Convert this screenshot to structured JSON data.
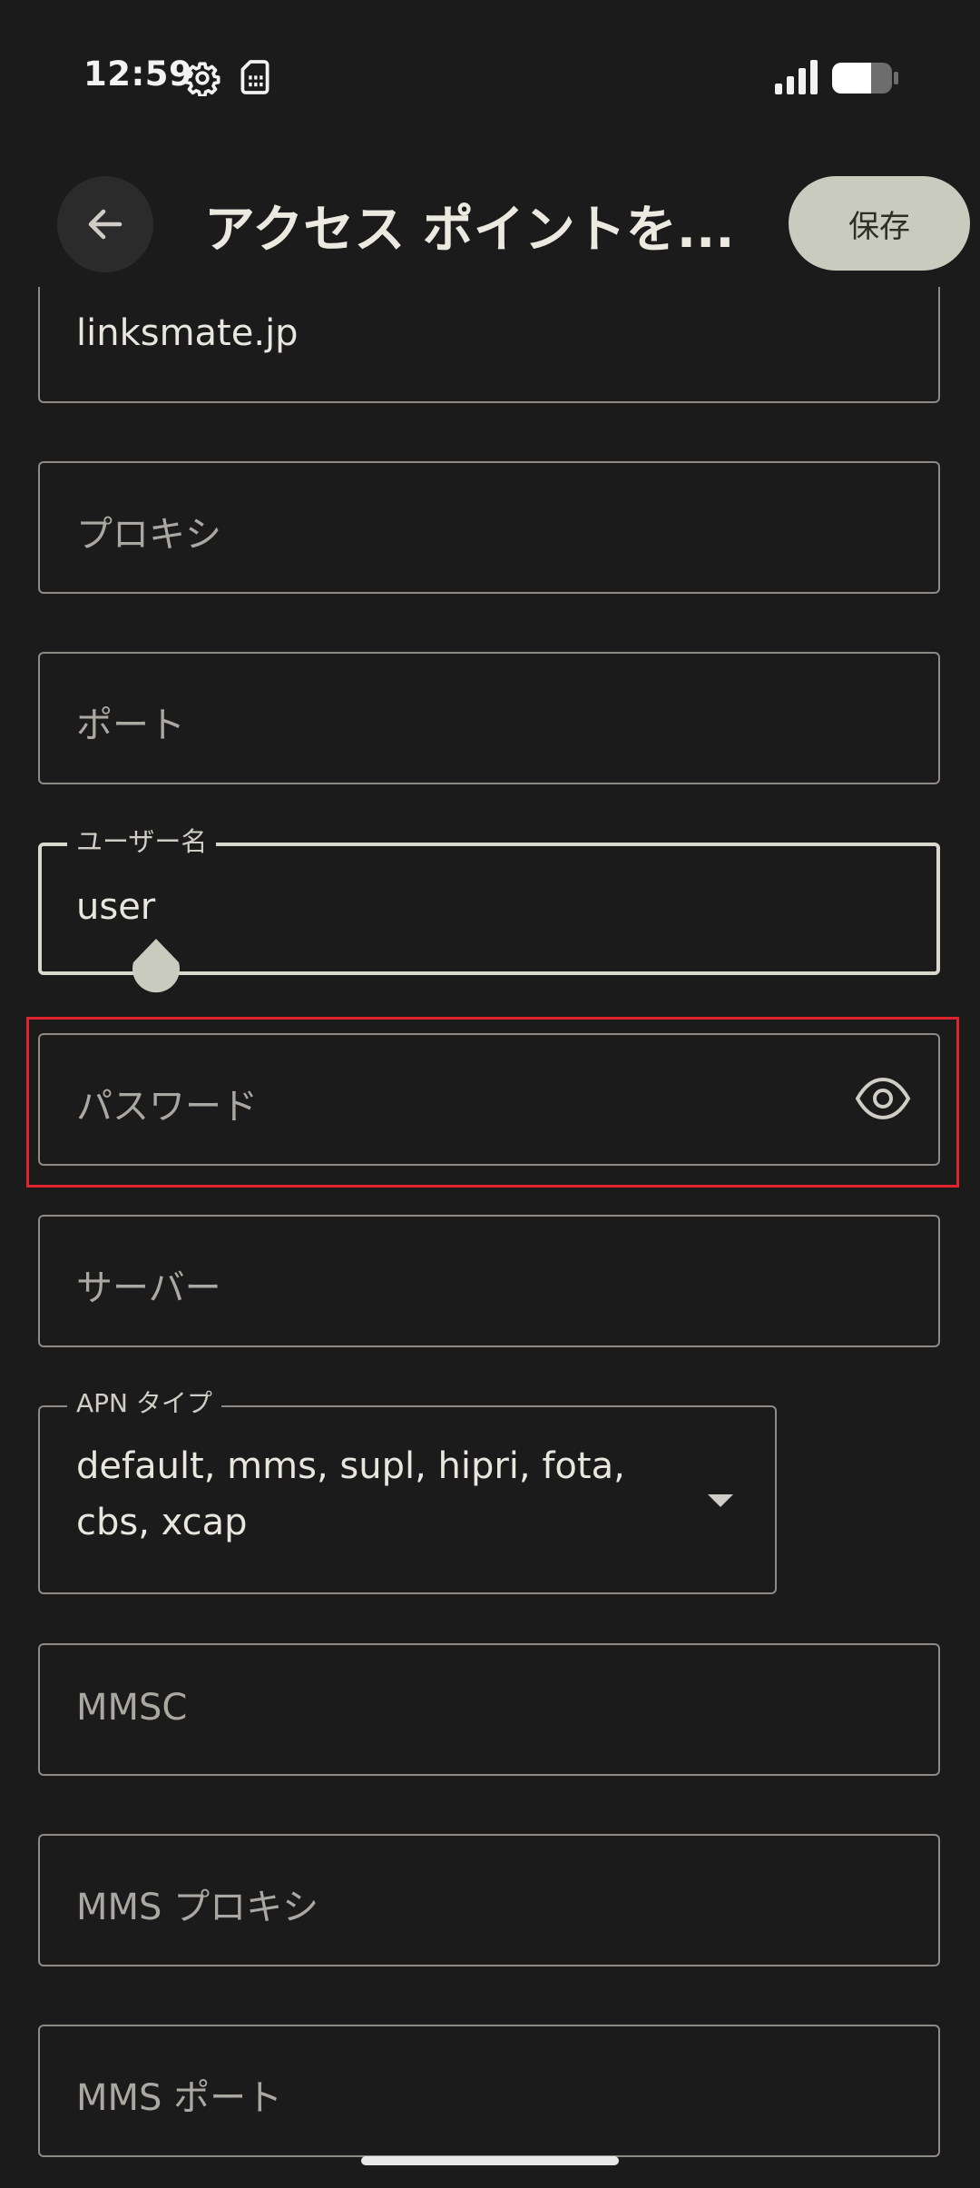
{
  "status_bar": {
    "time": "12:59",
    "icons": [
      "gear-icon",
      "sim-card-icon",
      "signal-icon",
      "battery-icon"
    ]
  },
  "app_bar": {
    "title": "アクセス ポイントを...",
    "save_label": "保存",
    "back_icon": "arrow-left-icon"
  },
  "fields": {
    "apn": {
      "value": "linksmate.jp"
    },
    "proxy": {
      "placeholder": "プロキシ"
    },
    "port": {
      "placeholder": "ポート"
    },
    "username": {
      "label": "ユーザー名",
      "value": "user"
    },
    "password": {
      "placeholder": "パスワード",
      "icon": "eye-icon"
    },
    "server": {
      "placeholder": "サーバー"
    },
    "apn_type": {
      "label": "APN タイプ",
      "value_line1": "default, mms, supl, hipri, fota,",
      "value_line2": "cbs, xcap"
    },
    "mmsc": {
      "placeholder": "MMSC"
    },
    "mms_proxy": {
      "placeholder": "MMS プロキシ"
    },
    "mms_port": {
      "placeholder": "MMS ポート"
    }
  },
  "colors": {
    "background": "#1b1b1b",
    "save_button": "#c8cbbe",
    "highlight": "#e0232c"
  }
}
